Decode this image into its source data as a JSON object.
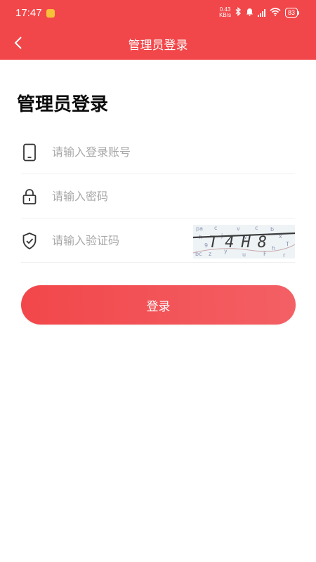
{
  "status_bar": {
    "time": "17:47",
    "net_speed_value": "0.43",
    "net_speed_unit": "KB/s",
    "battery": "83"
  },
  "nav": {
    "title": "管理员登录"
  },
  "heading": "管理员登录",
  "form": {
    "account_placeholder": "请输入登录账号",
    "password_placeholder": "请输入密码",
    "captcha_placeholder": "请输入验证码",
    "captcha_text": "T4H8"
  },
  "login_button": "登录",
  "colors": {
    "primary": "#f2474a"
  },
  "icons": {
    "back": "chevron-left-icon",
    "account": "phone-icon",
    "password": "lock-icon",
    "captcha": "shield-check-icon"
  }
}
